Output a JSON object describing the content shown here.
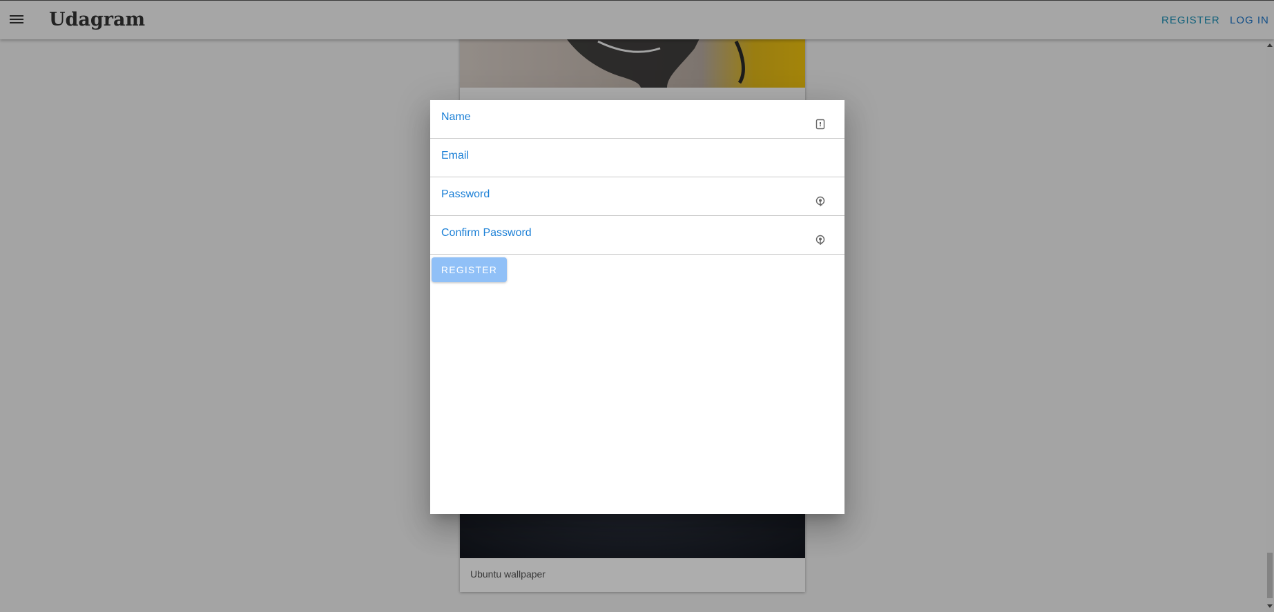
{
  "toolbar": {
    "brand": "Udagram",
    "register_label": "REGISTER",
    "login_label": "LOG IN",
    "menu_icon": "hamburger-menu-icon"
  },
  "feed": {
    "bottom_caption": "Ubuntu wallpaper"
  },
  "register_form": {
    "name_label": "Name",
    "email_label": "Email",
    "password_label": "Password",
    "confirm_password_label": "Confirm Password",
    "submit_label": "REGISTER",
    "name_value": "",
    "email_value": "",
    "password_value": "",
    "confirm_password_value": "",
    "icons": {
      "name": "id-badge-icon",
      "password": "key-icon",
      "confirm_password": "key-icon"
    }
  },
  "colors": {
    "accent": "#1a7fd6",
    "button_disabled": "#90c0f7",
    "nav_register": "#1a8fb5",
    "nav_login": "#1a73c8"
  }
}
